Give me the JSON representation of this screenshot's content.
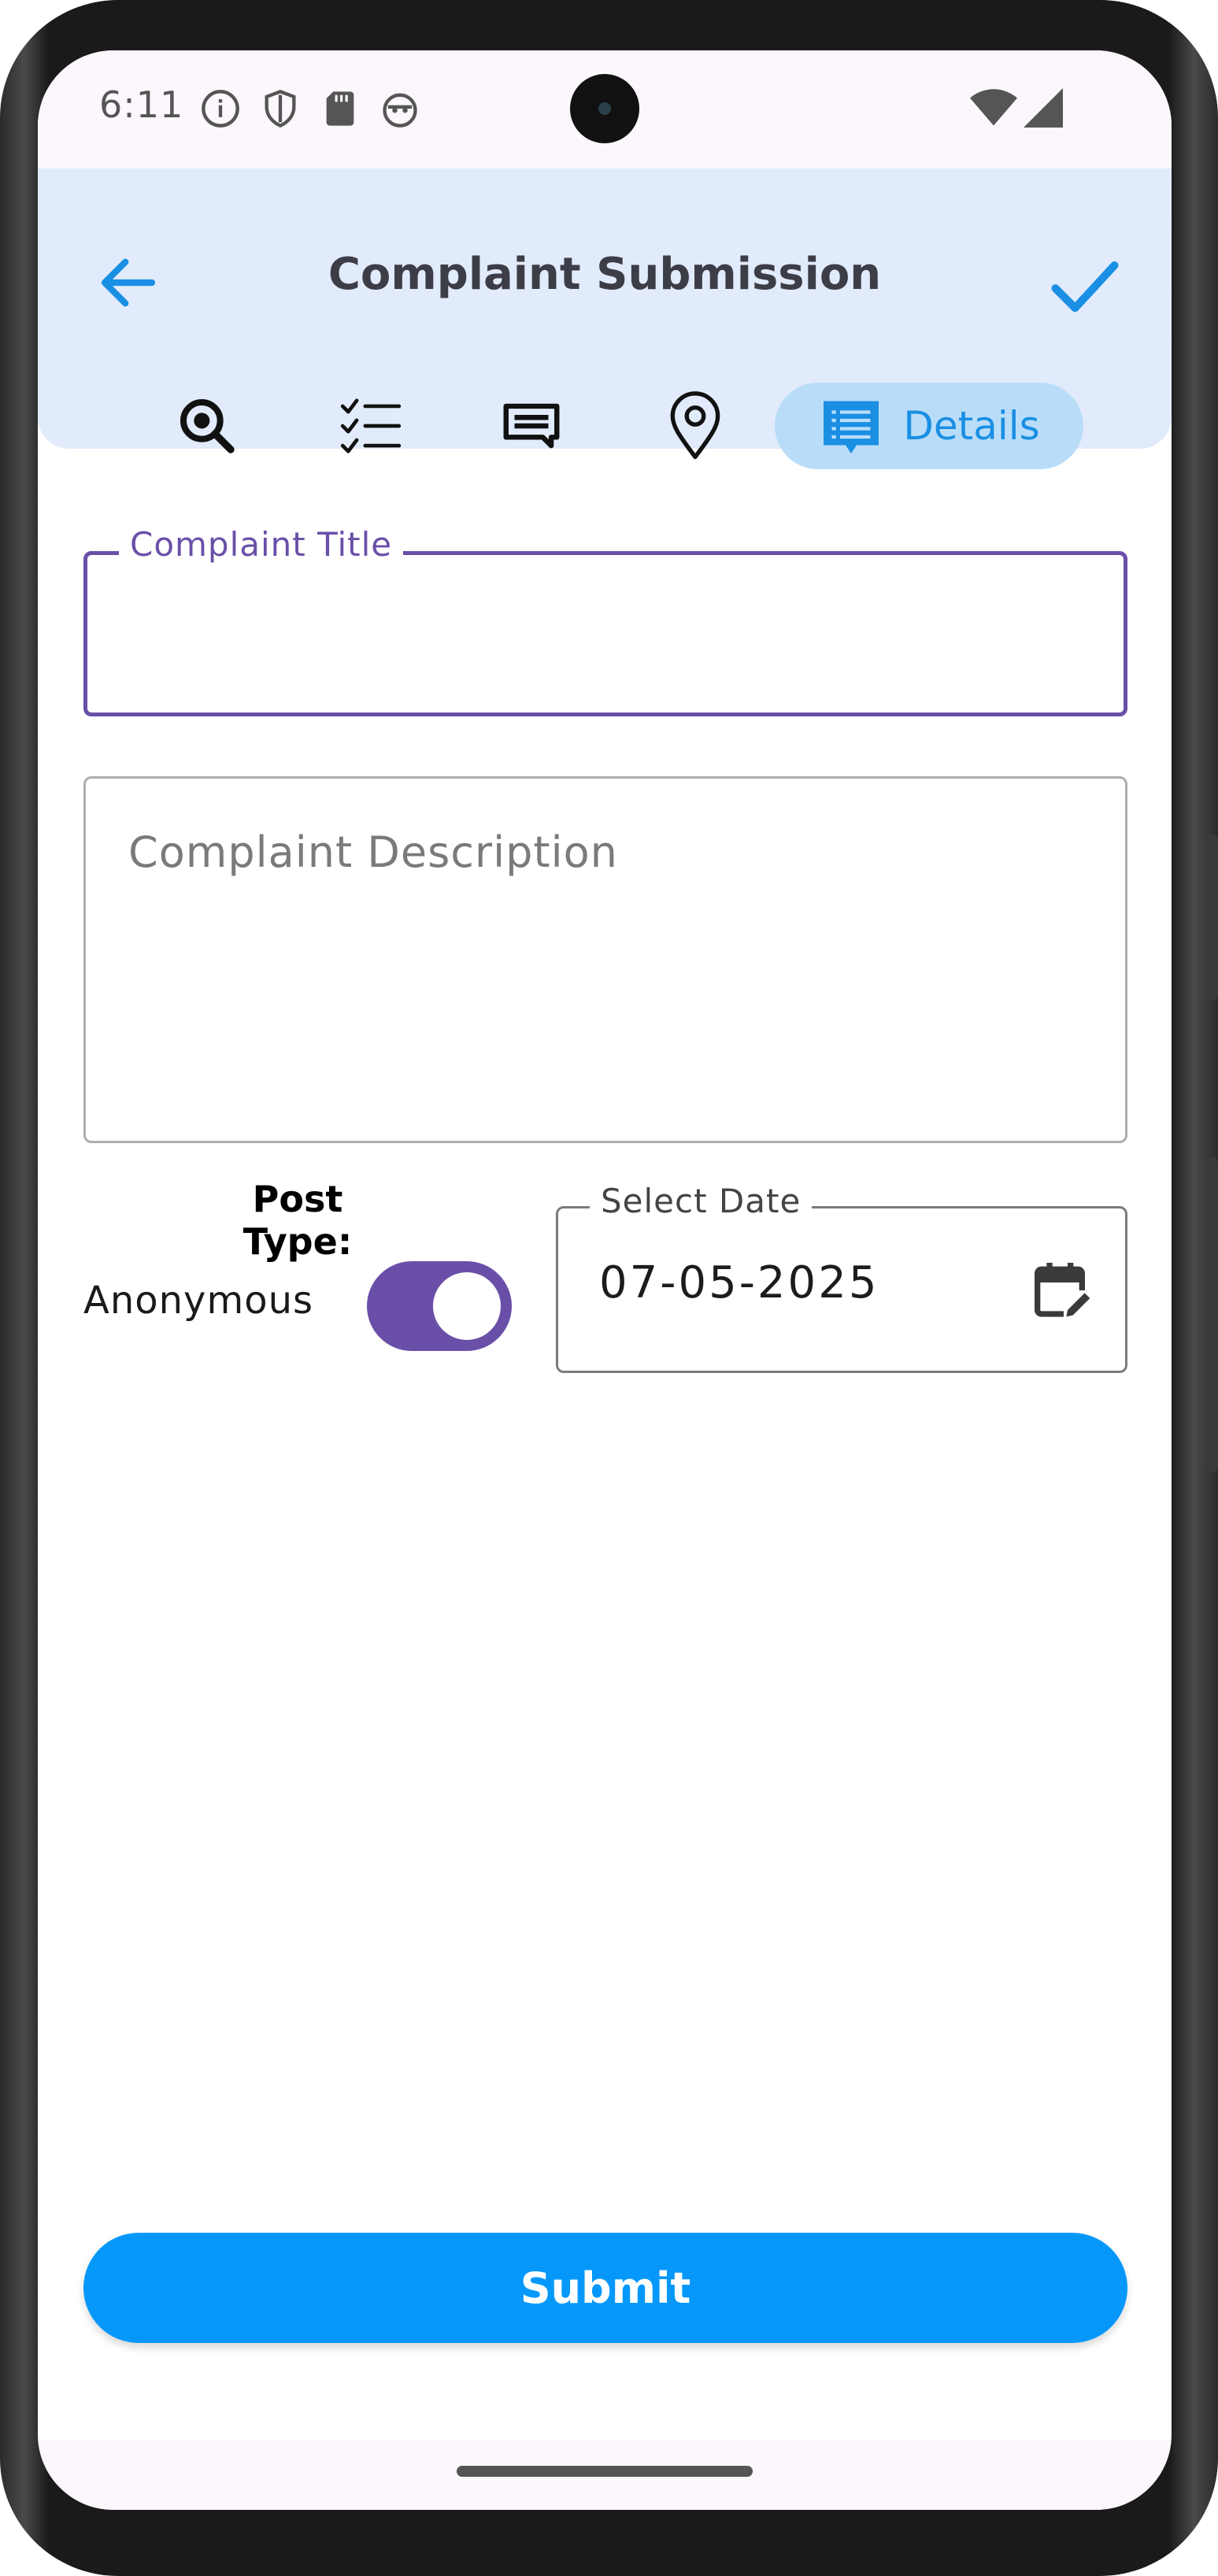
{
  "status_bar": {
    "time": "6:11",
    "icons": [
      "info-icon",
      "shield-icon",
      "sd-card-icon",
      "android-face-icon",
      "wifi-icon",
      "cellular-signal-icon"
    ]
  },
  "header": {
    "title": "Complaint Submission",
    "back_icon": "arrow-left-icon",
    "confirm_icon": "check-icon",
    "accent_color": "#1a8fe3",
    "background": "#e1ebfb"
  },
  "tabs": [
    {
      "icon": "search-icon",
      "label": "",
      "active": false
    },
    {
      "icon": "checklist-icon",
      "label": "",
      "active": false
    },
    {
      "icon": "message-icon",
      "label": "",
      "active": false
    },
    {
      "icon": "location-pin-icon",
      "label": "",
      "active": false
    },
    {
      "icon": "details-list-icon",
      "label": "Details",
      "active": true
    }
  ],
  "form": {
    "title_field": {
      "label": "Complaint Title",
      "value": ""
    },
    "description_field": {
      "placeholder": "Complaint Description",
      "value": ""
    },
    "post_type": {
      "label": "Post Type:",
      "option_label": "Anonymous",
      "enabled": true
    },
    "date_field": {
      "label": "Select Date",
      "value": "07-05-2025"
    },
    "accent_color": "#6a4fa8"
  },
  "actions": {
    "submit_label": "Submit",
    "submit_color": "#0598fa"
  }
}
